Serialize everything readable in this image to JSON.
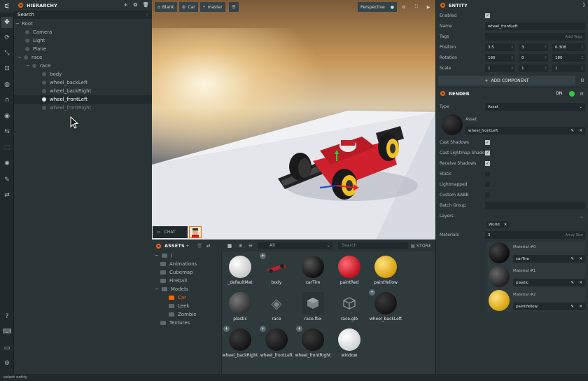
{
  "toolbar": {
    "tools": [
      "move-tool",
      "rotate-tool",
      "scale-tool",
      "resize-tool",
      "world-tool",
      "magnet-tool",
      "eye-tool",
      "redo-tool",
      "select-tool",
      "light-tool",
      "edit-tool",
      "code-tool",
      "help-tool",
      "keyboard-tool",
      "chat-tool",
      "settings-tool"
    ]
  },
  "hierarchy": {
    "title": "HIERARCHY",
    "search_placeholder": "Search",
    "items": [
      {
        "label": "Root"
      },
      {
        "label": "Camera"
      },
      {
        "label": "Light"
      },
      {
        "label": "Plane"
      },
      {
        "label": "race"
      },
      {
        "label": "race"
      },
      {
        "label": "body"
      },
      {
        "label": "wheel_backLeft"
      },
      {
        "label": "wheel_backRight"
      },
      {
        "label": "wheel_frontLeft"
      },
      {
        "label": "wheel_frontRight"
      }
    ]
  },
  "viewport": {
    "buttons": {
      "blank": "Blank",
      "car": "Car",
      "master": "master",
      "perspective": "Perspective"
    },
    "chat_label": "CHAT"
  },
  "assets": {
    "title": "ASSETS",
    "filter": "All",
    "search_placeholder": "Search",
    "store": "STORE",
    "folders": [
      {
        "label": "/"
      },
      {
        "label": "Animations"
      },
      {
        "label": "Cubemap"
      },
      {
        "label": "Fireball"
      },
      {
        "label": "Models"
      },
      {
        "label": "Car"
      },
      {
        "label": "Leek"
      },
      {
        "label": "Zombie"
      },
      {
        "label": "Textures"
      }
    ],
    "items": [
      {
        "label": "_defaultMat",
        "color": "#f0f0f0"
      },
      {
        "label": "body",
        "color": "#c0202c"
      },
      {
        "label": "carTire",
        "color": "#1c1c1c"
      },
      {
        "label": "paintRed",
        "color": "#e0202e"
      },
      {
        "label": "paintYellow",
        "color": "#f2c022"
      },
      {
        "label": "plastic",
        "color": "#4a4a4a"
      },
      {
        "label": "race",
        "color": "#7a8487"
      },
      {
        "label": "race.fbx",
        "color": "#7a8487"
      },
      {
        "label": "race.glb",
        "color": "#9aa3a5"
      },
      {
        "label": "wheel_backLeft",
        "color": "#2a2a2a"
      },
      {
        "label": "wheel_backRight",
        "color": "#2a2a2a"
      },
      {
        "label": "wheel_frontLeft",
        "color": "#2a2a2a"
      },
      {
        "label": "wheel_frontRight",
        "color": "#2a2a2a"
      },
      {
        "label": "window",
        "color": "#e8e8e8"
      }
    ]
  },
  "entity": {
    "title": "ENTITY",
    "enabled_label": "Enabled",
    "name_label": "Name",
    "name_value": "wheel_frontLeft",
    "tags_label": "Tags",
    "add_tags": "Add Tags",
    "position_label": "Position",
    "position": [
      "3.5",
      "3",
      "6.308"
    ],
    "rotation_label": "Rotation",
    "rotation": [
      "180",
      "0",
      "180"
    ],
    "scale_label": "Scale",
    "scale": [
      "1",
      "1",
      "1"
    ],
    "axes": [
      "X",
      "Y",
      "Z"
    ],
    "add_component": "ADD COMPONENT"
  },
  "render": {
    "title": "RENDER",
    "on": "ON",
    "type_label": "Type",
    "type_value": "Asset",
    "asset_label": "Asset",
    "asset_value": "wheel_frontLeft",
    "cast_shadows": "Cast Shadows",
    "cast_lightmap": "Cast Lightmap Shado...",
    "receive_shadows": "Receive Shadows",
    "static": "Static",
    "lightmapped": "Lightmapped",
    "custom_aabb": "Custom AABB",
    "batch_group": "Batch Group",
    "layers": "Layers",
    "layer_tag": "World",
    "materials_label": "Materials",
    "materials_count": "3",
    "array_size": "Array Size",
    "materials": [
      {
        "title": "Material #0",
        "name": "carTire",
        "color": "#1a1a1a"
      },
      {
        "title": "Material #1",
        "name": "plastic",
        "color": "#3a3a3a"
      },
      {
        "title": "Material #2",
        "name": "paintYellow",
        "color": "#f2c022"
      }
    ]
  },
  "status": "select entity"
}
